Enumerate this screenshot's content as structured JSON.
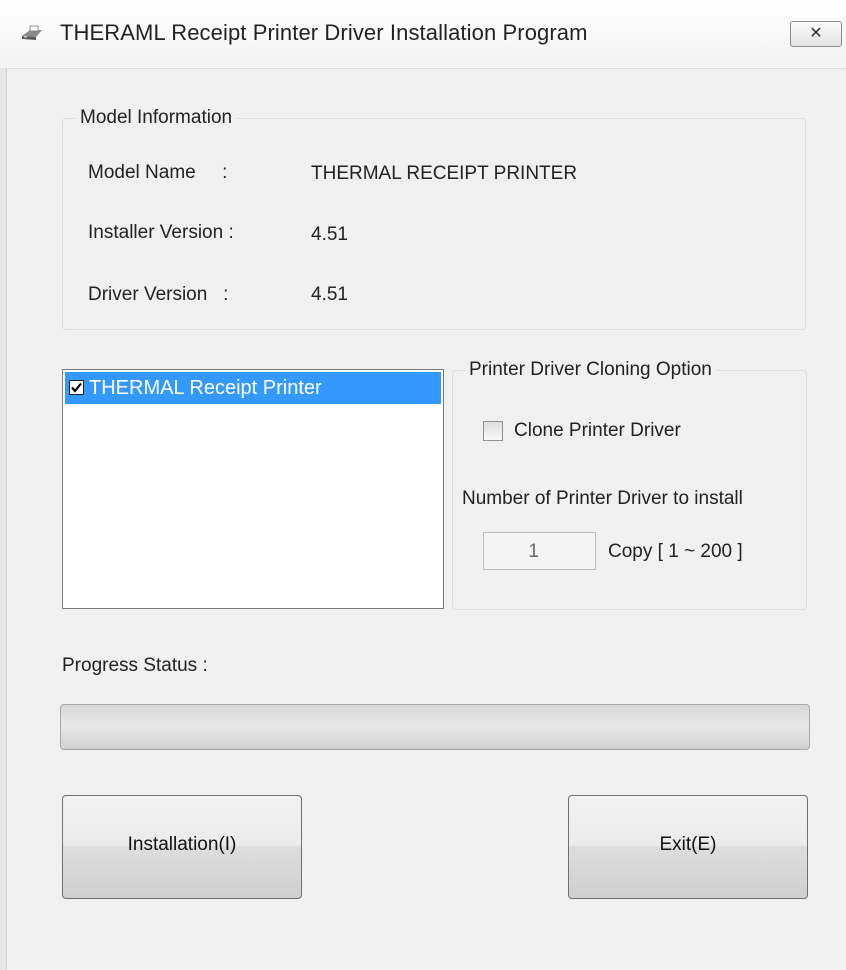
{
  "window": {
    "title": "THERAML Receipt Printer Driver Installation Program",
    "icon": "printer-icon",
    "close_glyph": "✕"
  },
  "model_info": {
    "group_label": "Model Information",
    "rows": [
      {
        "label": "Model Name     :",
        "value": "THERMAL RECEIPT PRINTER"
      },
      {
        "label": "Installer Version :",
        "value": "4.51"
      },
      {
        "label": "Driver Version   :",
        "value": "4.51"
      }
    ]
  },
  "printer_list": {
    "items": [
      {
        "label": "THERMAL Receipt Printer",
        "checked": true,
        "selected": true
      }
    ]
  },
  "cloning": {
    "group_label": "Printer Driver Cloning Option",
    "checkbox_label": "Clone Printer Driver",
    "checkbox_checked": false,
    "count_label": "Number of Printer Driver to install",
    "count_value": "1",
    "range_label": "Copy [ 1 ~ 200 ]"
  },
  "progress": {
    "label": "Progress Status :",
    "value": 0
  },
  "buttons": {
    "install_label": "Installation(I)",
    "exit_label": "Exit(E)"
  },
  "colors": {
    "selection": "#3399ff",
    "dialog_bg": "#f0f0f0"
  }
}
